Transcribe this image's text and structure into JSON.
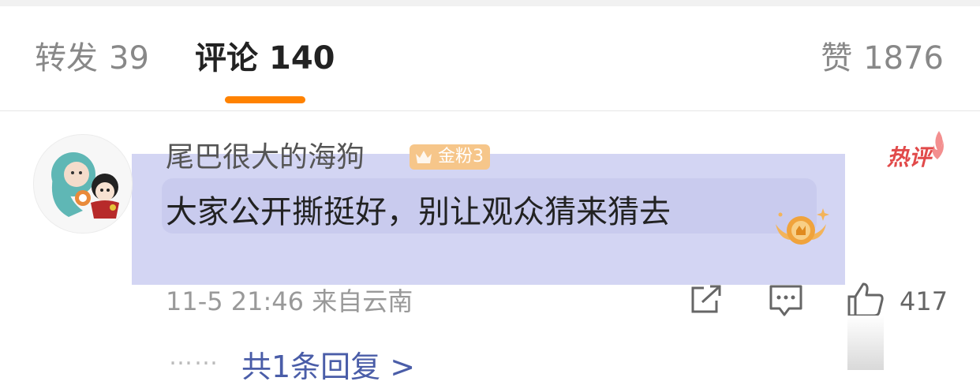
{
  "tabs": {
    "forward": {
      "label": "转发",
      "count": "39"
    },
    "comments": {
      "label": "评论",
      "count": "140"
    },
    "likes": {
      "label": "赞",
      "count": "1876"
    },
    "active_tab": "comments",
    "accent_color": "#ff8200"
  },
  "comment": {
    "username": "尾巴很大的海狗",
    "fan_badge": "金粉3",
    "hot_label": "热评",
    "text": "大家公开撕挺好，别让观众猜来猜去",
    "date": "11-5 21:46",
    "location": "来自云南",
    "like_count": "417",
    "replies_dots": "……",
    "replies_link": "共1条回复 >",
    "icons": [
      "avatar",
      "crown-icon",
      "flame-icon",
      "medal-icon",
      "share-icon",
      "reply-icon",
      "like-icon"
    ]
  },
  "colors": {
    "highlight": "#cfd1f2",
    "hot": "#e14a4a",
    "badge": "#f6c68a",
    "link": "#4a5da8"
  }
}
